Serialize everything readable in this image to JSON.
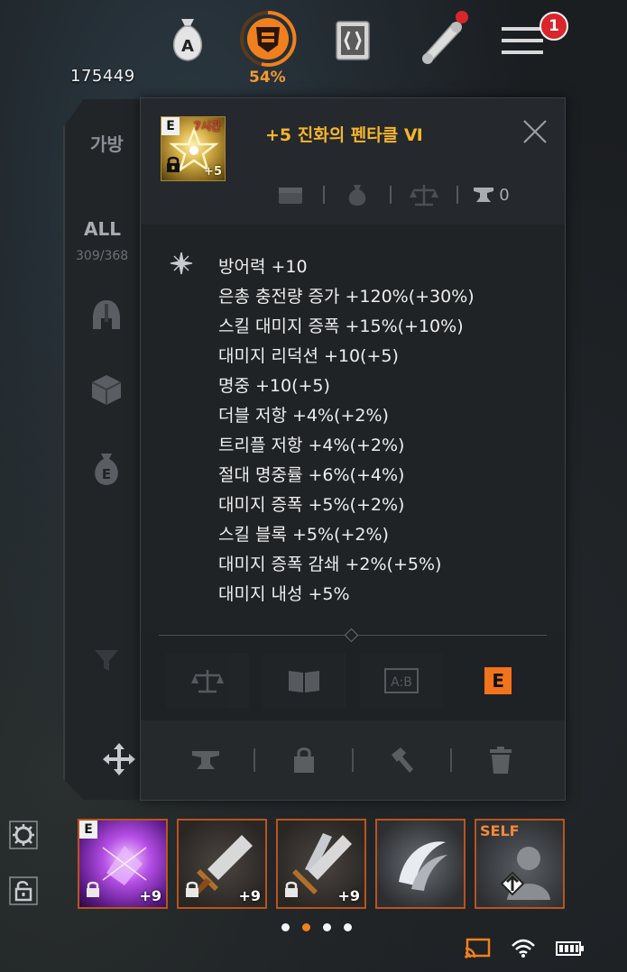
{
  "top_bar": {
    "gold_amount": "175449",
    "weight_percent": "54%",
    "notification_count": "1",
    "icons": [
      "money-bag-icon",
      "weight-shield-icon",
      "codex-icon",
      "quest-scroll-icon",
      "menu-icon"
    ]
  },
  "inventory": {
    "tab_label": "가방",
    "filter_label": "ALL",
    "slot_count": "309/368",
    "category_icons": [
      "helmet-icon",
      "box-icon",
      "bag-e-icon",
      "filter-icon"
    ]
  },
  "tooltip": {
    "grade": "E",
    "timer": "7시간",
    "enchant": "+5",
    "item_name": "+5 진화의 펜타클 Ⅵ",
    "repair_count": "0",
    "stats": [
      "방어력 +10",
      "은총 충전량 증가 +120%(+30%)",
      "스킬 대미지 증폭 +15%(+10%)",
      "대미지 리덕션 +10(+5)",
      "명중 +10(+5)",
      "더블 저항 +4%(+2%)",
      "트리플 저항 +4%(+2%)",
      "절대 명중률 +6%(+4%)",
      "대미지 증폭 +5%(+2%)",
      "스킬 블록 +5%(+2%)",
      "대미지 증폭 감쇄 +2%(+5%)",
      "대미지 내성 +5%"
    ],
    "option_e_label": "E"
  },
  "quick_slots": [
    {
      "grade": "E",
      "plus": "+9",
      "locked": true
    },
    {
      "grade": "",
      "plus": "+9",
      "locked": true
    },
    {
      "grade": "",
      "plus": "+9",
      "locked": true
    },
    {
      "grade": "",
      "plus": "",
      "locked": false
    },
    {
      "grade": "",
      "plus": "",
      "label": "SELF",
      "locked": false
    }
  ],
  "pager": {
    "pages": 4,
    "active_index": 1
  },
  "colors": {
    "accent": "#f0801d",
    "item_name": "#f5b52e",
    "badge": "#d8262c",
    "slot_border": "#b9541d"
  }
}
